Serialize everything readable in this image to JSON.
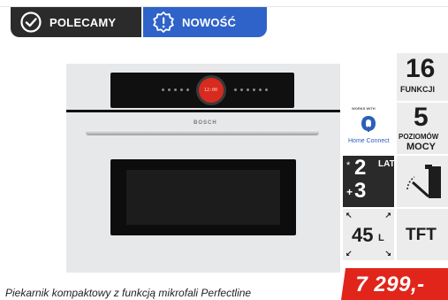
{
  "badges": {
    "polecamy": {
      "label": "POLECAMY",
      "icon": "checkmark-circle-icon",
      "color": "#2b2b2b"
    },
    "nowosc": {
      "label": "NOWOŚĆ",
      "icon": "exclamation-badge-icon",
      "color": "#2f63c9"
    }
  },
  "features": {
    "functions": {
      "number": "16",
      "label": "FUNKCJI"
    },
    "home_connect": {
      "top": "WORKS WITH",
      "label": "Home Connect",
      "icon": "home-connect-icon"
    },
    "power_levels": {
      "number": "5",
      "label1": "POZIOMÓW",
      "label2": "MOCY"
    },
    "warranty": {
      "star": "*",
      "first": "2",
      "plus": "+",
      "second": "3",
      "word": "LATA"
    },
    "door": {
      "icon": "door-open-icon"
    },
    "capacity": {
      "number": "45",
      "unit": "L",
      "icon": "expand-arrows-icon"
    },
    "display": {
      "label": "TFT"
    }
  },
  "product": {
    "image_alt": "built-in-oven",
    "brand_mark": "BOSCH",
    "caption": "Piekarnik kompaktowy z funkcją mikrofali Perfectline"
  },
  "price": {
    "value": "7 299,-",
    "color": "#e1251b"
  }
}
